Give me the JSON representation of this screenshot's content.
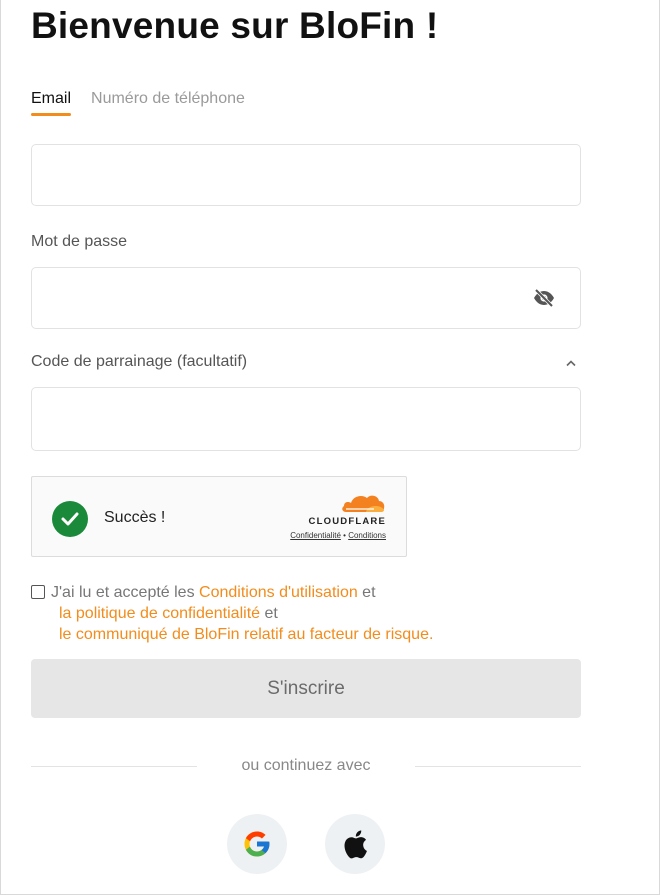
{
  "page": {
    "title": "Bienvenue sur BloFin !"
  },
  "tabs": [
    {
      "label": "Email",
      "active": true
    },
    {
      "label": "Numéro de téléphone",
      "active": false
    }
  ],
  "form": {
    "email": {
      "value": "",
      "placeholder": ""
    },
    "password": {
      "label": "Mot de passe",
      "value": "",
      "placeholder": "",
      "toggle_icon": "eye-off-icon"
    },
    "referral": {
      "label": "Code de parrainage (facultatif)",
      "value": "",
      "placeholder": "",
      "expand_icon": "chevron-up-icon"
    }
  },
  "captcha": {
    "status_text": "Succès !",
    "provider": "CLOUDFLARE",
    "privacy_link": "Confidentialité",
    "separator": "•",
    "terms_link": "Conditions",
    "status_color": "#1a8a3a"
  },
  "terms": {
    "prefix": "J'ai lu et accepté les ",
    "link1": "Conditions d'utilisation",
    "and1": " et",
    "link2": "la politique de confidentialité",
    "and2": " et",
    "link3": "le communiqué de BloFin relatif au facteur de risque.",
    "checked": false
  },
  "actions": {
    "signup_label": "S'inscrire"
  },
  "social": {
    "divider_text": "ou continuez avec",
    "providers": [
      {
        "name": "Google",
        "icon": "google-icon"
      },
      {
        "name": "Apple",
        "icon": "apple-icon"
      }
    ]
  },
  "colors": {
    "accent": "#f28c1c",
    "button_disabled_bg": "#e6e6e6",
    "social_bg": "#eef1f4"
  }
}
